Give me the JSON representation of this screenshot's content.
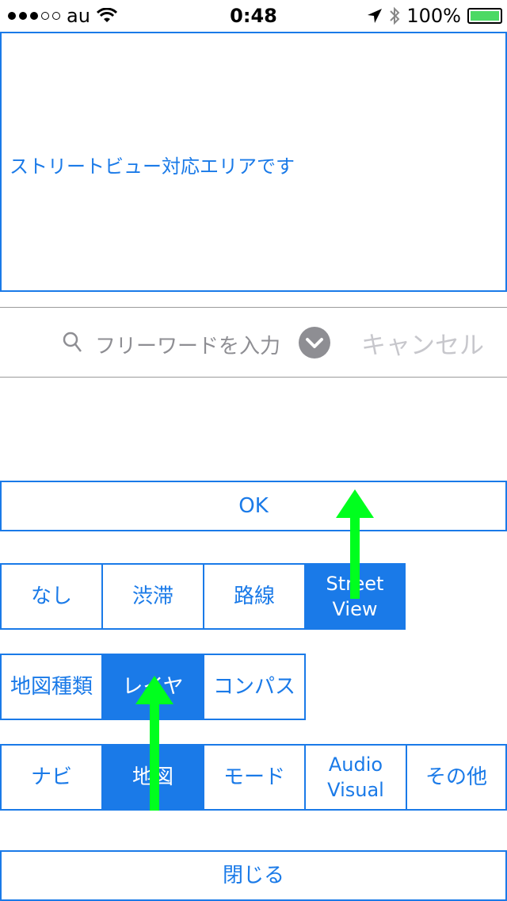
{
  "status_bar": {
    "carrier": "au",
    "time": "0:48",
    "battery": "100%"
  },
  "message": {
    "text": "ストリートビュー対応エリアです"
  },
  "search": {
    "placeholder": "フリーワードを入力",
    "cancel_label": "キャンセル"
  },
  "ok_label": "OK",
  "layer_options": [
    {
      "label": "なし",
      "selected": false
    },
    {
      "label": "渋滞",
      "selected": false
    },
    {
      "label": "路線",
      "selected": false
    },
    {
      "label": "Street View",
      "selected": true
    }
  ],
  "map_tabs": [
    {
      "label": "地図種類",
      "selected": false
    },
    {
      "label": "レイヤ",
      "selected": true
    },
    {
      "label": "コンパス",
      "selected": false
    }
  ],
  "main_tabs": [
    {
      "label": "ナビ",
      "selected": false
    },
    {
      "label": "地図",
      "selected": true
    },
    {
      "label": "モード",
      "selected": false
    },
    {
      "label": "Audio Visual",
      "selected": false
    },
    {
      "label": "その他",
      "selected": false
    }
  ],
  "close_label": "閉じる",
  "colors": {
    "accent": "#1a7ae8",
    "arrow": "#00ff1e",
    "battery": "#4cd964"
  }
}
